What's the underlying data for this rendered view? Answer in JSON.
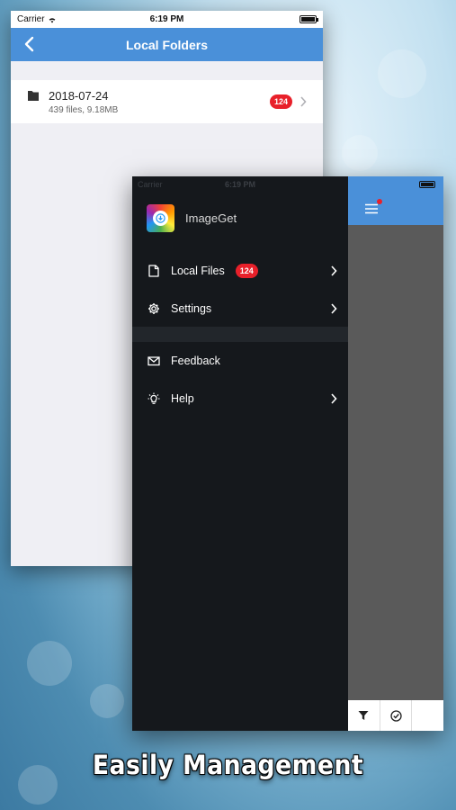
{
  "background": {
    "accent": "#4a90d9",
    "badge_color": "#e8202a"
  },
  "back_screen": {
    "status": {
      "carrier": "Carrier",
      "time": "6:19 PM"
    },
    "nav": {
      "back_icon": "chevron-left-icon",
      "title": "Local Folders"
    },
    "folders": [
      {
        "name": "2018-07-24",
        "meta": "439 files, 9.18MB",
        "badge": "124",
        "icon": "folder-icon"
      }
    ]
  },
  "front_screen": {
    "status": {
      "carrier": "Carrier",
      "time": "6:19 PM"
    },
    "app": {
      "name": "ImageGet",
      "logo_icon": "imageget-logo"
    },
    "menu": [
      {
        "label": "Local Files",
        "icon": "file-icon",
        "badge": "124",
        "chevron": true
      },
      {
        "label": "Settings",
        "icon": "gear-icon",
        "chevron": true
      },
      {
        "label": "Feedback",
        "icon": "envelope-icon",
        "chevron": false
      },
      {
        "label": "Help",
        "icon": "lightbulb-icon",
        "chevron": true
      }
    ],
    "toolbar": [
      {
        "icon": "filter-icon"
      },
      {
        "icon": "check-circle-icon"
      }
    ]
  },
  "caption": "Easily Management"
}
